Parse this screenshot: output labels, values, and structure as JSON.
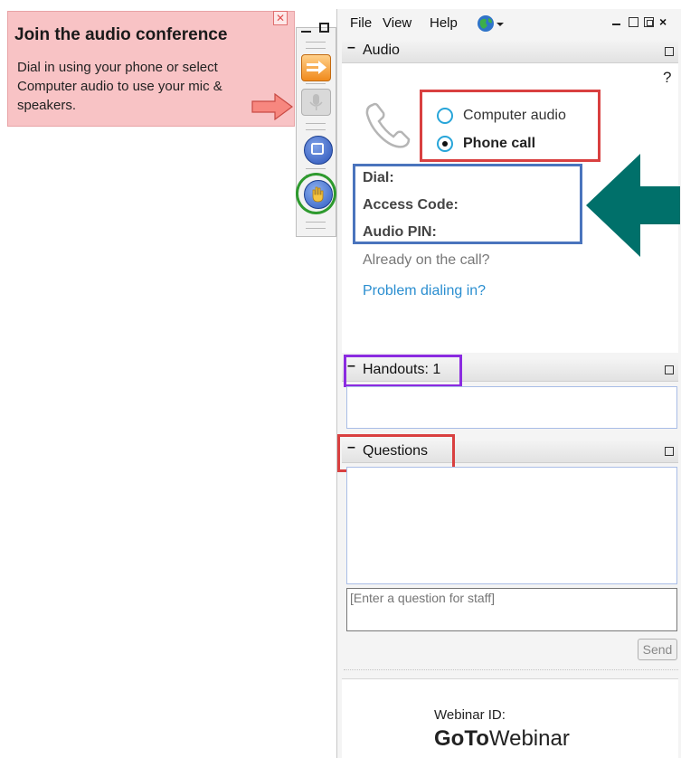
{
  "tooltip": {
    "title": "Join the audio conference",
    "body": "Dial in using your phone or select Computer audio to use your mic & speakers.",
    "close_icon": "close-icon"
  },
  "toolbar": {
    "buttons": [
      "orange-arrow-icon",
      "microphone-icon",
      "screen-share-icon",
      "raise-hand-icon"
    ]
  },
  "menu": {
    "file": "File",
    "view": "View",
    "help": "Help",
    "globe_icon": "globe-icon"
  },
  "audio": {
    "header": "Audio",
    "help": "?",
    "option_computer": "Computer audio",
    "option_phone": "Phone call",
    "selected": "Phone call",
    "dial_label": "Dial:",
    "access_code_label": "Access Code:",
    "audio_pin_label": "Audio PIN:",
    "already_on_call": "Already on the call?",
    "problem_dialing": "Problem dialing in?"
  },
  "handouts": {
    "header": "Handouts: 1"
  },
  "questions": {
    "header": "Questions",
    "input_placeholder": "[Enter a question for staff]",
    "send_label": "Send"
  },
  "footer": {
    "webinar_id_label": "Webinar ID:",
    "brand_bold": "GoTo",
    "brand_regular": "Webinar"
  },
  "colors": {
    "tooltip_bg": "#f8c3c5",
    "highlight_red": "#d94040",
    "highlight_blue": "#4a74bd",
    "highlight_purple": "#8b2be0",
    "highlight_green": "#2e9a2e",
    "arrow_teal": "#00706a",
    "link_blue": "#2a8ed0"
  }
}
